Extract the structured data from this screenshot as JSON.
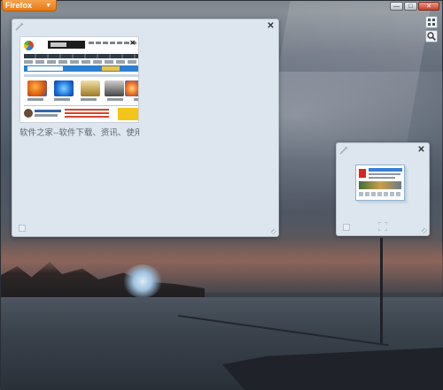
{
  "window": {
    "app_menu_label": "Firefox",
    "controls": {
      "minimize_glyph": "—",
      "maximize_glyph": "□",
      "close_glyph": "✕"
    }
  },
  "tools": {
    "exit_group_view_icon": "grid-view-icon",
    "search_icon": "search-icon"
  },
  "groups": [
    {
      "close_glyph": "✕",
      "tabs": [
        {
          "title": "软件之家--软件下载、资讯、使用技巧",
          "thumbnail": {
            "search_label": "",
            "close_glyph": "✕"
          }
        }
      ]
    },
    {
      "close_glyph": "✕",
      "tabs_stacked": true
    }
  ],
  "colors": {
    "app_menu": "#e77a14",
    "group_bg": "#dde6ee",
    "search_bar": "#2b7fd0"
  }
}
